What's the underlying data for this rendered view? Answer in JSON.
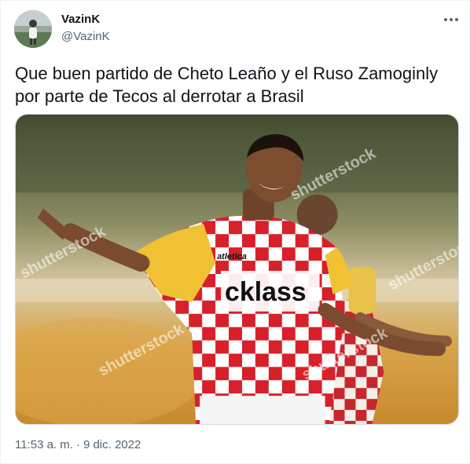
{
  "author": {
    "name": "VazinK",
    "handle": "@VazinK"
  },
  "icons": {
    "more": "more-horizontal-icon",
    "avatar": "user-avatar"
  },
  "tweet": {
    "text": "Que buen partido de Cheto Leaño y el Ruso Zamoginly por parte de Tecos al derrotar a Brasil",
    "time": "11:53 a. m.",
    "separator": "·",
    "date": "9 dic. 2022"
  },
  "media": {
    "jersey_sponsor": "cklass",
    "jersey_brand": "atletica",
    "watermark": "shutterstock"
  },
  "colors": {
    "text": "#0f1419",
    "secondary": "#536471",
    "jersey_red": "#d8202a"
  }
}
